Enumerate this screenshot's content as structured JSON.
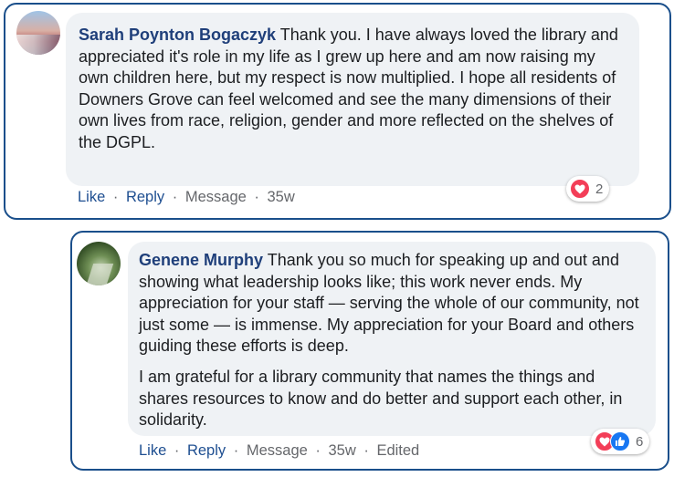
{
  "comments": [
    {
      "author": "Sarah Poynton Bogaczyk",
      "text": " Thank you. I have always loved the library and appreciated it's role in my life as I grew up here and am now raising my own children here, but my respect is now multiplied. I hope all residents of Downers Grove can feel welcomed and see the many dimensions of their own lives from race, religion, gender and more reflected on the shelves of the DGPL.",
      "actions": {
        "like": "Like",
        "reply": "Reply",
        "message": "Message",
        "time": "35w"
      },
      "reactions": {
        "icons": [
          "heart-icon"
        ],
        "count": "2"
      }
    },
    {
      "author": "Genene Murphy",
      "text": " Thank you so much for speaking up and out and showing what leadership looks like; this work never ends. My appreciation for your staff — serving the whole of our community, not just some — is immense. My appreciation for your Board and others guiding these efforts is deep.",
      "text2": "I am grateful for a library community that names the things and shares resources to know and do better and support each other, in solidarity.",
      "actions": {
        "like": "Like",
        "reply": "Reply",
        "message": "Message",
        "time": "35w",
        "edited": "Edited"
      },
      "reactions": {
        "icons": [
          "heart-icon",
          "thumbs-up-icon"
        ],
        "count": "6"
      }
    }
  ],
  "separator": "·",
  "colors": {
    "frame_border": "#1a4f8b",
    "bubble_bg": "#eff2f5",
    "author": "#1f3f7a",
    "action_link": "#1f4f91",
    "meta": "#65676b",
    "love": "#f33e58",
    "like": "#1877f2"
  }
}
